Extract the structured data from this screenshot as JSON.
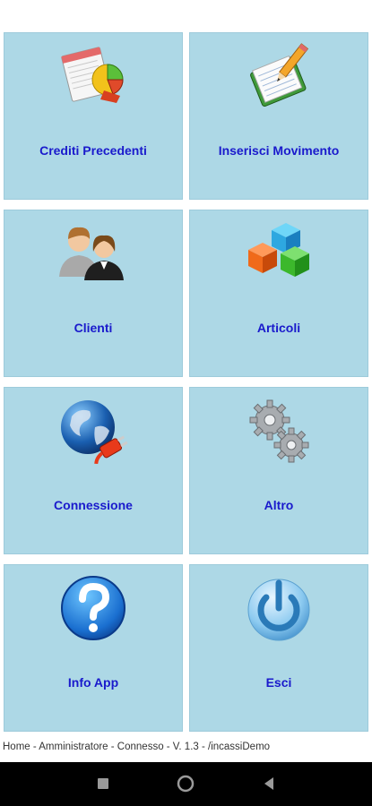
{
  "tiles": [
    {
      "label": "Crediti Precedenti",
      "icon": "report-chart-icon"
    },
    {
      "label": "Inserisci Movimento",
      "icon": "notebook-pencil-icon"
    },
    {
      "label": "Clienti",
      "icon": "users-icon"
    },
    {
      "label": "Articoli",
      "icon": "cubes-icon"
    },
    {
      "label": "Connessione",
      "icon": "globe-plug-icon"
    },
    {
      "label": "Altro",
      "icon": "gears-icon"
    },
    {
      "label": "Info App",
      "icon": "help-icon"
    },
    {
      "label": "Esci",
      "icon": "power-icon"
    }
  ],
  "status_bar": {
    "text": "Home - Amministratore  - Connesso - V. 1.3 - /incassiDemo"
  },
  "nav": {
    "back": "back-icon",
    "home": "home-icon",
    "recents": "recents-icon"
  },
  "colors": {
    "tile_bg": "#add8e6",
    "label": "#1a1acc"
  }
}
